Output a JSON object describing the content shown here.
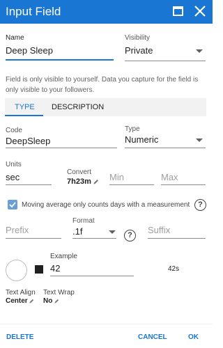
{
  "dialog": {
    "title": "Input Field"
  },
  "name": {
    "label": "Name",
    "value": "Deep Sleep"
  },
  "visibility": {
    "label": "Visibility",
    "value": "Private"
  },
  "note": "Field is only visible to yourself. Data you capture for the field is only visible to your followers.",
  "tabs": [
    {
      "label": "TYPE",
      "active": true
    },
    {
      "label": "DESCRIPTION",
      "active": false
    }
  ],
  "code": {
    "label": "Code",
    "value": "DeepSleep"
  },
  "type": {
    "label": "Type",
    "value": "Numeric"
  },
  "units": {
    "label": "Units",
    "value": "sec"
  },
  "convert": {
    "label": "Convert",
    "value": "7h23m"
  },
  "min": {
    "placeholder": "Min"
  },
  "max": {
    "placeholder": "Max"
  },
  "moving_average": {
    "label": "Moving average only counts days with a measurement",
    "checked": true
  },
  "prefix": {
    "placeholder": "Prefix"
  },
  "format": {
    "label": "Format",
    "value": ".1f"
  },
  "suffix": {
    "placeholder": "Suffix"
  },
  "example": {
    "label": "Example",
    "value": "42",
    "output": "42s"
  },
  "text_align": {
    "label": "Text Align",
    "value": "Center"
  },
  "text_wrap": {
    "label": "Text Wrap",
    "value": "No"
  },
  "footer": {
    "delete": "DELETE",
    "cancel": "CANCEL",
    "ok": "OK"
  },
  "colors": {
    "accent": "#1976d2",
    "checkbox": "#6a9fd8"
  }
}
